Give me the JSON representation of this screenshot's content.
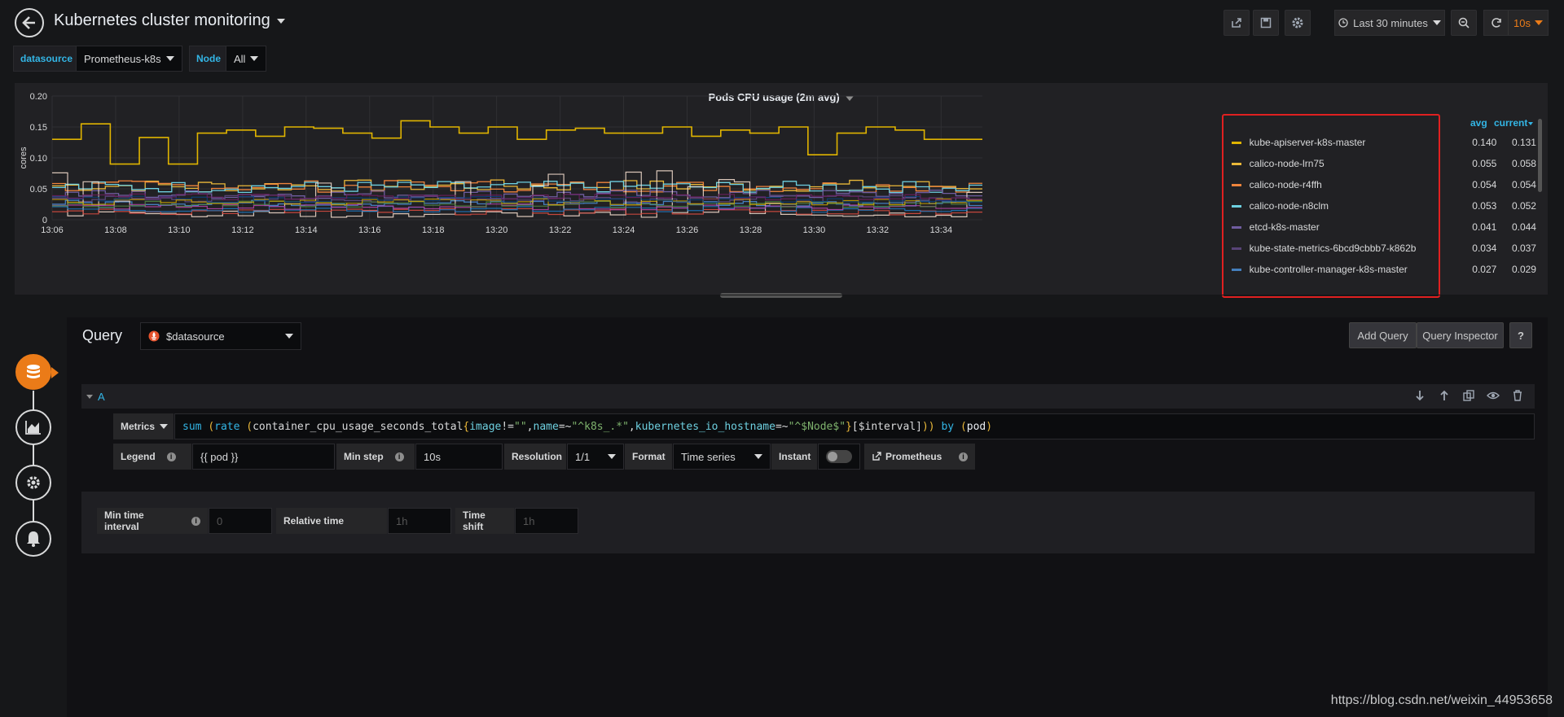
{
  "header": {
    "title": "Kubernetes cluster monitoring",
    "time_range": "Last 30 minutes",
    "refresh_interval": "10s"
  },
  "variables": [
    {
      "label": "datasource",
      "value": "Prometheus-k8s"
    },
    {
      "label": "Node",
      "value": "All"
    }
  ],
  "panel": {
    "title": "Pods CPU usage (2m avg)",
    "legend_headers": {
      "avg": "avg",
      "current": "current"
    },
    "legend": [
      {
        "name": "kube-apiserver-k8s-master",
        "avg": "0.140",
        "current": "0.131",
        "color": "#e0b400"
      },
      {
        "name": "calico-node-lrn75",
        "avg": "0.055",
        "current": "0.058",
        "color": "#eab839"
      },
      {
        "name": "calico-node-r4ffh",
        "avg": "0.054",
        "current": "0.054",
        "color": "#ef843c"
      },
      {
        "name": "calico-node-n8clm",
        "avg": "0.053",
        "current": "0.052",
        "color": "#6ed0e0"
      },
      {
        "name": "etcd-k8s-master",
        "avg": "0.041",
        "current": "0.044",
        "color": "#705da0"
      },
      {
        "name": "kube-state-metrics-6bcd9cbbb7-k862b",
        "avg": "0.034",
        "current": "0.037",
        "color": "#584477"
      },
      {
        "name": "kube-controller-manager-k8s-master",
        "avg": "0.027",
        "current": "0.029",
        "color": "#447ebc"
      }
    ]
  },
  "chart_data": {
    "type": "line",
    "title": "Pods CPU usage (2m avg)",
    "ylabel": "cores",
    "ylim": [
      0,
      0.2
    ],
    "yticks": [
      "0",
      "0.05",
      "0.10",
      "0.15",
      "0.20"
    ],
    "xticks": [
      "13:06",
      "13:08",
      "13:10",
      "13:12",
      "13:14",
      "13:16",
      "13:18",
      "13:20",
      "13:22",
      "13:24",
      "13:26",
      "13:28",
      "13:30",
      "13:32",
      "13:34"
    ],
    "series": [
      {
        "name": "kube-apiserver-k8s-master",
        "color": "#e0b400",
        "x": [
          "13:06",
          "13:06:30",
          "13:07",
          "13:08",
          "13:08:30",
          "13:09",
          "13:10",
          "13:11",
          "13:12",
          "13:13",
          "13:14",
          "13:15",
          "13:16",
          "13:17",
          "13:18",
          "13:19",
          "13:20",
          "13:21",
          "13:22",
          "13:23",
          "13:24",
          "13:25",
          "13:26",
          "13:27",
          "13:28",
          "13:29",
          "13:30",
          "13:31",
          "13:32",
          "13:33",
          "13:34",
          "13:35"
        ],
        "y": [
          0.13,
          0.155,
          0.09,
          0.133,
          0.09,
          0.14,
          0.145,
          0.135,
          0.15,
          0.148,
          0.14,
          0.132,
          0.16,
          0.15,
          0.14,
          0.15,
          0.13,
          0.145,
          0.148,
          0.14,
          0.14,
          0.15,
          0.135,
          0.145,
          0.14,
          0.15,
          0.105,
          0.14,
          0.15,
          0.145,
          0.13,
          0.13
        ]
      },
      {
        "name": "calico-node-lrn75",
        "color": "#eab839",
        "y_avg": 0.055
      },
      {
        "name": "calico-node-r4ffh",
        "color": "#ef843c",
        "y_avg": 0.054
      },
      {
        "name": "calico-node-n8clm",
        "color": "#6ed0e0",
        "y_avg": 0.053
      },
      {
        "name": "etcd-k8s-master",
        "color": "#705da0",
        "y_avg": 0.041
      },
      {
        "name": "kube-state-metrics-6bcd9cbbb7-k862b",
        "color": "#584477",
        "y_avg": 0.034
      },
      {
        "name": "kube-controller-manager-k8s-master",
        "color": "#447ebc",
        "y_avg": 0.027
      }
    ]
  },
  "query": {
    "heading": "Query",
    "datasource": "$datasource",
    "add_query": "Add Query",
    "inspector": "Query Inspector",
    "help": "?",
    "ref_id": "A",
    "metrics_label": "Metrics",
    "expr_parts": [
      "sum ",
      "(",
      "rate ",
      "(",
      "container_cpu_usage_seconds_total",
      "{",
      "image",
      "!=",
      "\"\"",
      ",",
      "name",
      "=~",
      "\"^k8s_.*\"",
      ",",
      "kubernetes_io_hostname",
      "=~",
      "\"^$Node$\"",
      "}",
      "[$interval]",
      "))",
      " by ",
      "(",
      "pod",
      ")"
    ],
    "legend_label": "Legend",
    "legend_value": "{{ pod }}",
    "min_step_label": "Min step",
    "min_step_value": "10s",
    "resolution_label": "Resolution",
    "resolution_value": "1/1",
    "format_label": "Format",
    "format_value": "Time series",
    "instant_label": "Instant",
    "source_label": "Prometheus",
    "min_interval_label": "Min time interval",
    "min_interval_placeholder": "0",
    "relative_time_label": "Relative time",
    "relative_time_placeholder": "1h",
    "time_shift_label": "Time shift",
    "time_shift_placeholder": "1h"
  },
  "watermark": "https://blog.csdn.net/weixin_44953658"
}
